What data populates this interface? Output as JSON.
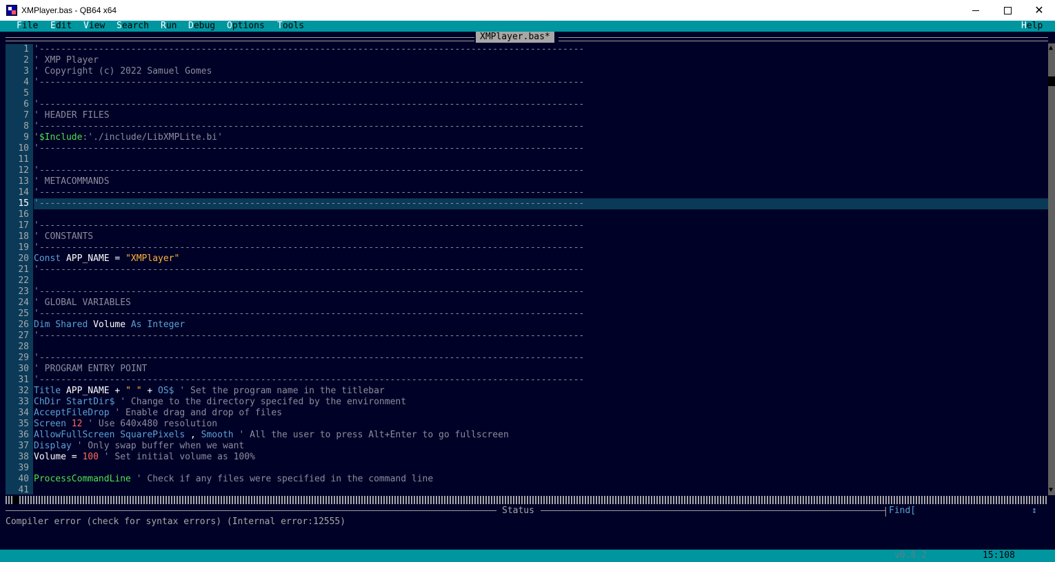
{
  "window": {
    "title": "XMPlayer.bas - QB64 x64",
    "icon": "qb64-app-icon",
    "controls": {
      "minimize": "minimize-icon",
      "maximize": "maximize-icon",
      "close": "✕"
    }
  },
  "menu": {
    "items": [
      {
        "hot": "F",
        "rest": "ile"
      },
      {
        "hot": "E",
        "rest": "dit"
      },
      {
        "hot": "V",
        "rest": "iew"
      },
      {
        "hot": "S",
        "rest": "earch"
      },
      {
        "hot": "R",
        "rest": "un"
      },
      {
        "hot": "D",
        "rest": "ebug"
      },
      {
        "hot": "O",
        "rest": "ptions"
      },
      {
        "hot": "T",
        "rest": "ools"
      }
    ],
    "help": {
      "hot": "H",
      "rest": "elp"
    }
  },
  "editor": {
    "tab_title": "XMPlayer.bas*",
    "current_line": 15,
    "line_numbers": [
      "1",
      "2",
      "3",
      "4",
      "5",
      "6",
      "7",
      "8",
      "9",
      "10",
      "11",
      "12",
      "13",
      "14",
      "15",
      "16",
      "17",
      "18",
      "19",
      "20",
      "21",
      "22",
      "23",
      "24",
      "25",
      "26",
      "27",
      "28",
      "29",
      "30",
      "31",
      "32",
      "33",
      "34",
      "35",
      "36",
      "37",
      "38",
      "39",
      "40",
      "41"
    ],
    "lines": [
      [
        [
          "c-comment",
          "'-----------------------------------------------------------------------------------------------------"
        ]
      ],
      [
        [
          "c-comment",
          "' XMP Player"
        ]
      ],
      [
        [
          "c-comment",
          "' Copyright (c) 2022 Samuel Gomes"
        ]
      ],
      [
        [
          "c-comment",
          "'-----------------------------------------------------------------------------------------------------"
        ]
      ],
      [],
      [
        [
          "c-comment",
          "'-----------------------------------------------------------------------------------------------------"
        ]
      ],
      [
        [
          "c-comment",
          "' HEADER FILES"
        ]
      ],
      [
        [
          "c-comment",
          "'-----------------------------------------------------------------------------------------------------"
        ]
      ],
      [
        [
          "c-comment",
          "'"
        ],
        [
          "c-meta",
          "$Include"
        ],
        [
          "c-comment",
          ":'./include/LibXMPLite.bi'"
        ]
      ],
      [
        [
          "c-comment",
          "'-----------------------------------------------------------------------------------------------------"
        ]
      ],
      [],
      [
        [
          "c-comment",
          "'-----------------------------------------------------------------------------------------------------"
        ]
      ],
      [
        [
          "c-comment",
          "' METACOMMANDS"
        ]
      ],
      [
        [
          "c-comment",
          "'-----------------------------------------------------------------------------------------------------"
        ]
      ],
      [
        [
          "c-comment",
          "'-----------------------------------------------------------------------------------------------------"
        ]
      ],
      [],
      [
        [
          "c-comment",
          "'-----------------------------------------------------------------------------------------------------"
        ]
      ],
      [
        [
          "c-comment",
          "' CONSTANTS"
        ]
      ],
      [
        [
          "c-comment",
          "'-----------------------------------------------------------------------------------------------------"
        ]
      ],
      [
        [
          "c-kw",
          "Const "
        ],
        [
          "c-id",
          "APP_NAME = "
        ],
        [
          "c-str",
          "\"XMPlayer\""
        ]
      ],
      [
        [
          "c-comment",
          "'-----------------------------------------------------------------------------------------------------"
        ]
      ],
      [],
      [
        [
          "c-comment",
          "'-----------------------------------------------------------------------------------------------------"
        ]
      ],
      [
        [
          "c-comment",
          "' GLOBAL VARIABLES"
        ]
      ],
      [
        [
          "c-comment",
          "'-----------------------------------------------------------------------------------------------------"
        ]
      ],
      [
        [
          "c-kw",
          "Dim Shared "
        ],
        [
          "c-id",
          "Volume "
        ],
        [
          "c-kw",
          "As Integer"
        ]
      ],
      [
        [
          "c-comment",
          "'-----------------------------------------------------------------------------------------------------"
        ]
      ],
      [],
      [
        [
          "c-comment",
          "'-----------------------------------------------------------------------------------------------------"
        ]
      ],
      [
        [
          "c-comment",
          "' PROGRAM ENTRY POINT"
        ]
      ],
      [
        [
          "c-comment",
          "'-----------------------------------------------------------------------------------------------------"
        ]
      ],
      [
        [
          "c-kw",
          "Title "
        ],
        [
          "c-id",
          "APP_NAME + "
        ],
        [
          "c-str",
          "\" \""
        ],
        [
          "c-id",
          " + "
        ],
        [
          "c-kw",
          "OS$"
        ],
        [
          "c-comment",
          " ' Set the program name in the titlebar"
        ]
      ],
      [
        [
          "c-kw",
          "ChDir StartDir$"
        ],
        [
          "c-comment",
          " ' Change to the directory specifed by the environment"
        ]
      ],
      [
        [
          "c-kw",
          "AcceptFileDrop"
        ],
        [
          "c-comment",
          " ' Enable drag and drop of files"
        ]
      ],
      [
        [
          "c-kw",
          "Screen "
        ],
        [
          "c-num",
          "12"
        ],
        [
          "c-comment",
          " ' Use 640x480 resolution"
        ]
      ],
      [
        [
          "c-kw",
          "AllowFullScreen SquarePixels "
        ],
        [
          "c-id",
          ", "
        ],
        [
          "c-kw",
          "Smooth"
        ],
        [
          "c-comment",
          " ' All the user to press Alt+Enter to go fullscreen"
        ]
      ],
      [
        [
          "c-kw",
          "Display"
        ],
        [
          "c-comment",
          " ' Only swap buffer when we want"
        ]
      ],
      [
        [
          "c-id",
          "Volume = "
        ],
        [
          "c-num",
          "100"
        ],
        [
          "c-comment",
          " ' Set initial volume as 100%"
        ]
      ],
      [],
      [
        [
          "c-sub",
          "ProcessCommandLine"
        ],
        [
          "c-comment",
          " ' Check if any files were specified in the command line"
        ]
      ],
      []
    ]
  },
  "status": {
    "title": "Status",
    "message": "Compiler error (check for syntax errors) (Internal error:12555)",
    "find_label": "Find[",
    "find_arrow": "↕",
    "version": "v0.8.2",
    "cursor_position": "15:108"
  },
  "colors": {
    "background": "#000126",
    "menubar": "#0096a0",
    "current_line": "#0a3a58",
    "comment": "#8c8c9e",
    "keyword": "#5aa3d8",
    "string": "#ffb33a",
    "number": "#ff6a5c",
    "metacommand": "#4ee04e"
  }
}
